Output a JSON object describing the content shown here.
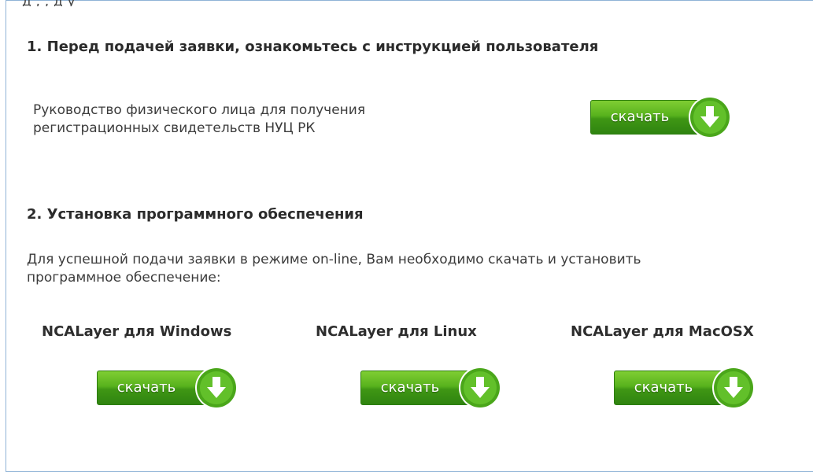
{
  "top_partial_text": "д                          ,                  ,  д  у",
  "section1": {
    "heading": "1. Перед подачей заявки, ознакомьтесь с инструкцией пользователя",
    "description_line1": "Руководство физического лица для получения",
    "description_line2": "регистрационных свидетельств НУЦ РК",
    "download_label": "скачать"
  },
  "section2": {
    "heading": "2. Установка программного обеспечения",
    "paragraph_line1": "Для успешной подачи заявки в режиме on-line, Вам необходимо скачать и установить",
    "paragraph_line2": "программное обеспечение:",
    "platforms": [
      {
        "name": "NCALayer для Windows",
        "download_label": "скачать"
      },
      {
        "name": "NCALayer для Linux",
        "download_label": "скачать"
      },
      {
        "name": "NCALayer для  MacOSX",
        "download_label": "скачать"
      }
    ]
  },
  "colors": {
    "button_green": "#4aa61a",
    "frame_border": "#8fb3d6",
    "text": "#333333"
  }
}
